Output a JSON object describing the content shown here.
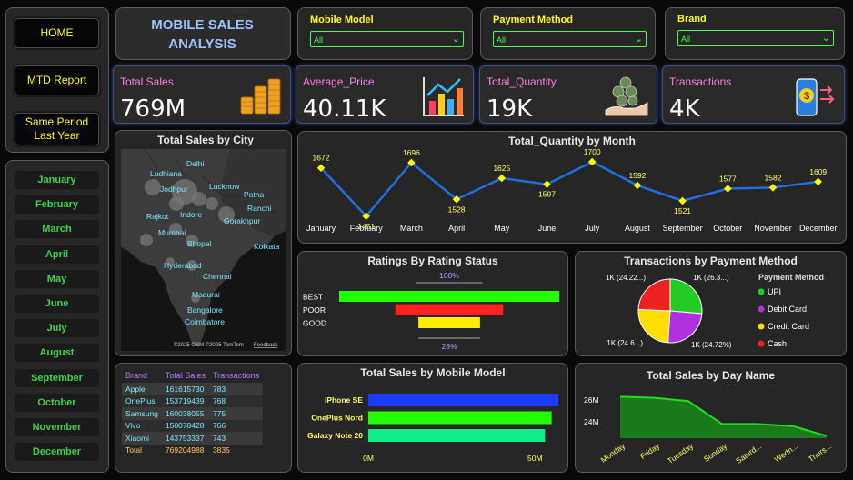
{
  "nav": {
    "home": "HOME",
    "mtd": "MTD Report",
    "same_period": "Same Period Last Year"
  },
  "months": [
    "January",
    "February",
    "March",
    "April",
    "May",
    "June",
    "July",
    "August",
    "September",
    "October",
    "November",
    "December"
  ],
  "header_title": "MOBILE SALES ANALYSIS",
  "filters": [
    {
      "label": "Mobile Model",
      "value": "All"
    },
    {
      "label": "Payment Method",
      "value": "All"
    },
    {
      "label": "Brand",
      "value": "All"
    }
  ],
  "kpis": [
    {
      "label": "Total Sales",
      "value": "769M",
      "icon": "coins-icon"
    },
    {
      "label": "Average_Price",
      "value": "40.11K",
      "icon": "bar-chart-icon"
    },
    {
      "label": "Total_Quantity",
      "value": "19K",
      "icon": "money-hand-icon"
    },
    {
      "label": "Transactions",
      "value": "4K",
      "icon": "phone-payment-icon"
    }
  ],
  "map": {
    "title": "Total Sales by City",
    "cities": [
      "Delhi",
      "Ludhiana",
      "Jodhpur",
      "Lucknow",
      "Patna",
      "Rajkot",
      "Indore",
      "Ranchi",
      "Gorakhpur",
      "Mumbai",
      "Bhopal",
      "Kolkata",
      "Hyderabad",
      "Chennai",
      "Madurai",
      "Bangalore",
      "Coimbatore"
    ],
    "attribution": "©2025 OSM  ©2025 TomTom",
    "feedback": "Feedback"
  },
  "colors": {
    "accent_yellow": "#ffff00",
    "green": "#3ad34a",
    "pink": "#ff7de0",
    "line_blue": "#1f6fe0"
  },
  "chart_data": [
    {
      "type": "line",
      "title": "Total_Quantity by Month",
      "categories": [
        "January",
        "February",
        "March",
        "April",
        "May",
        "June",
        "July",
        "August",
        "September",
        "October",
        "November",
        "December"
      ],
      "values": [
        1672,
        1451,
        1696,
        1528,
        1625,
        1597,
        1700,
        1592,
        1521,
        1577,
        1582,
        1609
      ],
      "ylim": [
        1400,
        1750
      ]
    },
    {
      "type": "bar",
      "title": "Ratings By Rating Status",
      "categories": [
        "BEST",
        "POOR",
        "GOOD"
      ],
      "values": [
        100,
        49,
        28
      ],
      "top_label": "100%",
      "bottom_label": "28%",
      "colors": [
        "#22ff00",
        "#ff2020",
        "#ffee00"
      ]
    },
    {
      "type": "pie",
      "title": "Transactions by Payment Method",
      "legend_title": "Payment Method",
      "categories": [
        "UPI",
        "Debit Card",
        "Credit Card",
        "Cash"
      ],
      "values": [
        26.3,
        24.72,
        24.6,
        24.22
      ],
      "labels": [
        "1K (26.3...)",
        "1K (24.72%)",
        "1K (24.6...)",
        "1K (24.22...)"
      ],
      "colors": [
        "#22cc22",
        "#b030e0",
        "#ffdd00",
        "#ee2222"
      ]
    },
    {
      "type": "table",
      "columns": [
        "Brand",
        "Total Sales",
        "Transactions"
      ],
      "rows": [
        [
          "Apple",
          "161615730",
          "783"
        ],
        [
          "OnePlus",
          "153719439",
          "768"
        ],
        [
          "Samsung",
          "160038055",
          "775"
        ],
        [
          "Vivo",
          "150078428",
          "766"
        ],
        [
          "Xiaomi",
          "143753337",
          "743"
        ]
      ],
      "total": [
        "Total",
        "769204988",
        "3835"
      ]
    },
    {
      "type": "bar",
      "title": "Total Sales by Mobile Model",
      "categories": [
        "iPhone SE",
        "OnePlus Nord",
        "Galaxy Note 20"
      ],
      "values": [
        57,
        55,
        53
      ],
      "unit": "M",
      "xticks": [
        "0M",
        "50M"
      ],
      "xlim": [
        0,
        60
      ],
      "colors": [
        "#1a3cff",
        "#22ff00",
        "#11ee88"
      ]
    },
    {
      "type": "area",
      "title": "Total Sales by Day Name",
      "categories": [
        "Monday",
        "Friday",
        "Tuesday",
        "Sunday",
        "Saturd...",
        "Wedn...",
        "Thurs..."
      ],
      "values": [
        26.3,
        26.2,
        25.9,
        23.8,
        23.8,
        23.6,
        22.7
      ],
      "yticks": [
        "26M",
        "24M"
      ],
      "ylim": [
        22.5,
        27
      ]
    }
  ]
}
